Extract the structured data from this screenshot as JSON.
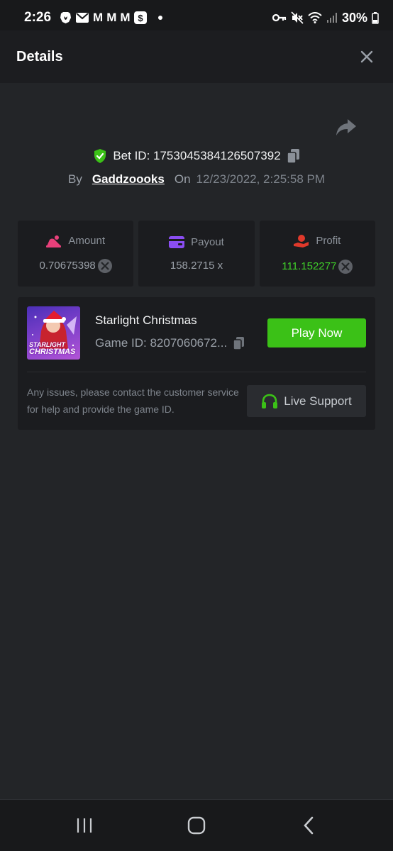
{
  "status_bar": {
    "time": "2:26",
    "icons": [
      "brave-icon",
      "mail-icon",
      "gmail-icon",
      "gmail-icon",
      "gmail-icon",
      "cash-app-icon",
      "notification-dot"
    ],
    "right_icons": [
      "vpn-key-icon",
      "mute-icon",
      "wifi-icon",
      "signal-icon",
      "battery-icon"
    ],
    "battery": "30%"
  },
  "header": {
    "title": "Details"
  },
  "bet": {
    "id_label": "Bet ID: 1753045384126507392",
    "by_label": "By",
    "username": "Gaddzoooks",
    "on_label": "On",
    "date": "12/23/2022, 2:25:58 PM"
  },
  "stats": {
    "amount": {
      "label": "Amount",
      "value": "0.70675398"
    },
    "payout": {
      "label": "Payout",
      "value": "158.2715 x"
    },
    "profit": {
      "label": "Profit",
      "value": "111.152277"
    }
  },
  "game": {
    "title": "Starlight Christmas",
    "id_label": "Game ID: 8207060672...",
    "thumb_line1": "STARLIGHT",
    "thumb_line2": "CHRISTMAS",
    "play_label": "Play Now",
    "notice": "Any issues, please contact the customer service for help and provide the game ID.",
    "support_label": "Live Support"
  },
  "colors": {
    "accent_green": "#3bc117",
    "profit_green": "#3fcf2a",
    "amount_pink": "#e8407a",
    "payout_purple": "#8a4df2",
    "profit_red": "#e0392b",
    "background": "#232528"
  }
}
